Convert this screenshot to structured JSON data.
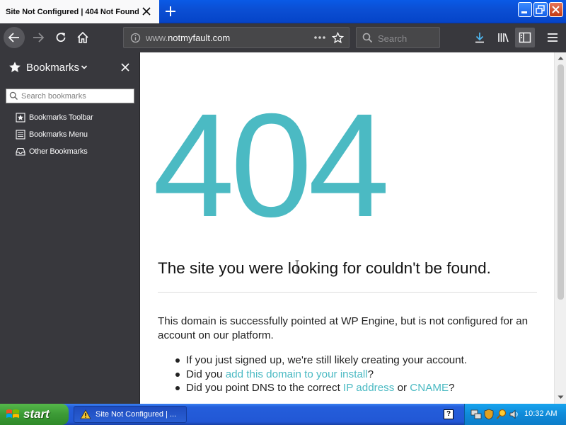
{
  "browser": {
    "tab": {
      "title": "Site Not Configured | 404 Not Found"
    },
    "url": {
      "prefix": "www.",
      "domain": "notmyfault.com"
    },
    "search": {
      "placeholder": "Search"
    }
  },
  "sidebar": {
    "title": "Bookmarks",
    "search_placeholder": "Search bookmarks",
    "items": [
      {
        "label": "Bookmarks Toolbar",
        "icon": "bookmarks-toolbar-icon"
      },
      {
        "label": "Bookmarks Menu",
        "icon": "bookmarks-menu-icon"
      },
      {
        "label": "Other Bookmarks",
        "icon": "other-bookmarks-icon"
      }
    ]
  },
  "page": {
    "big_code": "404",
    "headline": "The site you were looking for couldn't be found.",
    "description": "This domain is successfully pointed at WP Engine, but is not configured for an account on our platform.",
    "bullets": [
      {
        "text": "If you just signed up, we're still likely creating your account."
      },
      {
        "pre": "Did you ",
        "link": "add this domain to your install",
        "post": "?"
      },
      {
        "pre": "Did you point DNS to the correct ",
        "link1": "IP address",
        "mid": " or ",
        "link2": "CNAME",
        "post": "?"
      }
    ],
    "accent_color": "#4bbac3"
  },
  "taskbar": {
    "start_label": "start",
    "task_label": "Site Not Configured | ...",
    "help_label": "?",
    "clock": "10:32 AM"
  }
}
